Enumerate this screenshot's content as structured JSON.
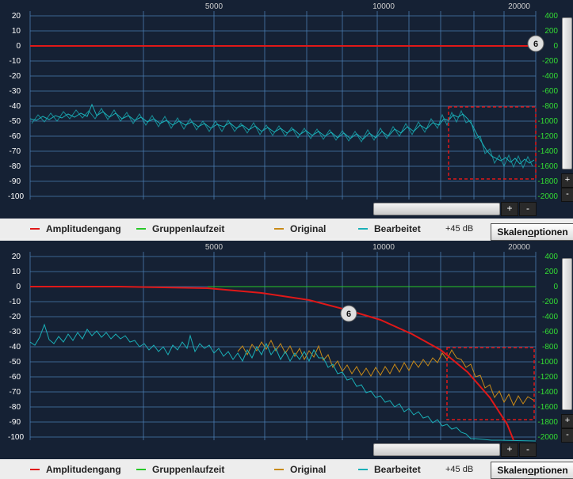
{
  "frequency_labels": [
    "5000",
    "10000",
    "20000"
  ],
  "db_labels": [
    "20",
    "10",
    "0",
    "-10",
    "-20",
    "-30",
    "-40",
    "-50",
    "-60",
    "-70",
    "-80",
    "-90",
    "-100"
  ],
  "ms_labels": [
    "400",
    "200",
    "0",
    "-200",
    "-400",
    "-600",
    "-800",
    "-1000",
    "-1200",
    "-1400",
    "-1600",
    "-1800",
    "-2000"
  ],
  "marker_label": "6",
  "legend": {
    "amplitude": "Amplitudengang",
    "group_delay": "Gruppenlaufzeit",
    "original": "Original",
    "edited": "Bearbeitet",
    "gain": "+45 dB",
    "options_button_pre": "Skalen",
    "options_button_u": "o",
    "options_button_post": "ptionen"
  },
  "controls": {
    "zoom_in": "+",
    "zoom_out": "-"
  },
  "colors": {
    "plot_background": "#152134",
    "grid": "#4a7cb0",
    "amplitude": "#e01818",
    "group_delay": "#28c828",
    "original": "#c88a18",
    "edited": "#1ab0b8",
    "db_axis_text": "#ffffff",
    "ms_axis_text": "#33dd33",
    "selection": "#e01818"
  },
  "icons": {
    "marker": "numbered-marker-icon"
  }
}
